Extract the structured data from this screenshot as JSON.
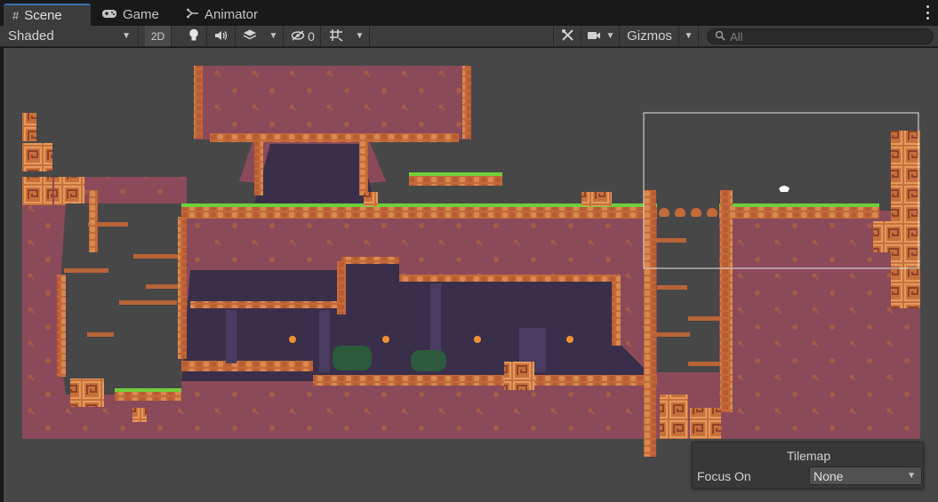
{
  "tabs": [
    {
      "label": "Scene",
      "icon": "grid-icon"
    },
    {
      "label": "Game",
      "icon": "gamepad-icon"
    },
    {
      "label": "Animator",
      "icon": "animator-icon"
    }
  ],
  "toolbar": {
    "draw_mode": "Shaded",
    "mode_2d": "2D",
    "hidden_count": "0",
    "gizmos_label": "Gizmos",
    "search_placeholder": "All"
  },
  "overlay": {
    "title": "Tilemap",
    "focus_label": "Focus On",
    "focus_value": "None"
  },
  "colors": {
    "tab_accent": "#3a72b0",
    "viewport_bg": "#474747",
    "ground": "#8a4a5a",
    "cave_dark": "#3a2f4a",
    "brick": "#c46a3a",
    "grass": "#6fcf3a"
  }
}
